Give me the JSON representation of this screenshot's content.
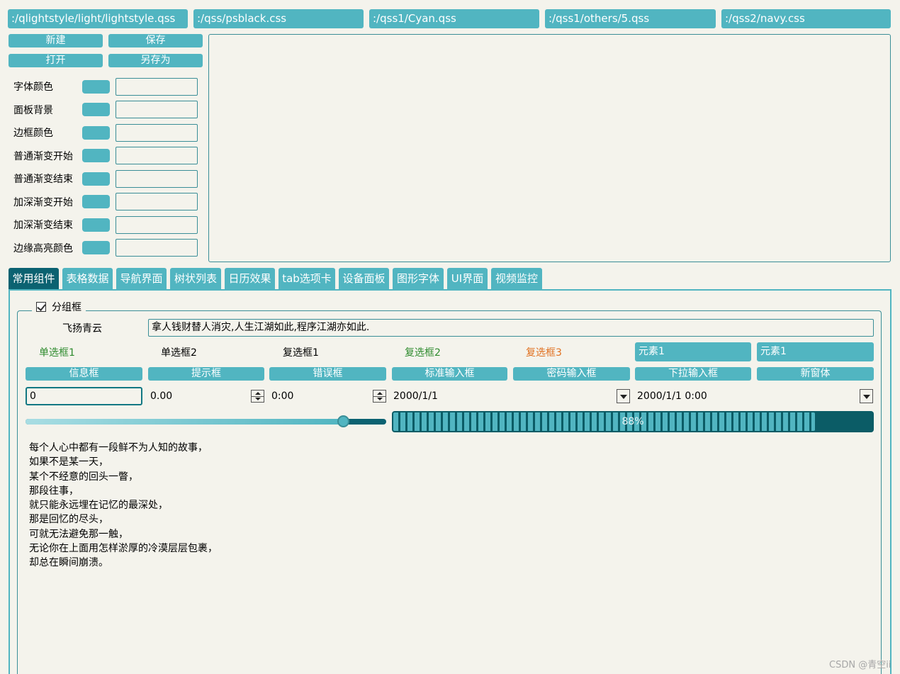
{
  "style_files": [
    ":/qlightstyle/light/lightstyle.qss",
    ":/qss/psblack.css",
    ":/qss1/Cyan.qss",
    ":/qss1/others/5.qss",
    ":/qss2/navy.css"
  ],
  "file_buttons": {
    "new": "新建",
    "save": "保存",
    "open": "打开",
    "save_as": "另存为"
  },
  "color_rows": [
    "字体颜色",
    "面板背景",
    "边框颜色",
    "普通渐变开始",
    "普通渐变结束",
    "加深渐变开始",
    "加深渐变结束",
    "边缘高亮颜色"
  ],
  "tabs": [
    "常用组件",
    "表格数据",
    "导航界面",
    "树状列表",
    "日历效果",
    "tab选项卡",
    "设备面板",
    "图形字体",
    "UI界面",
    "视频监控"
  ],
  "active_tab": "常用组件",
  "group": {
    "title": "分组框",
    "checked": true
  },
  "name_label": "飞扬青云",
  "line_edit_value": "拿人钱财替人消灾,人生江湖如此,程序江湖亦如此.",
  "radios": [
    "单选框1",
    "单选框2"
  ],
  "checks": [
    "复选框1",
    "复选框2",
    "复选框3"
  ],
  "element_combos": [
    "元素1",
    "元素1"
  ],
  "action_buttons": [
    "信息框",
    "提示框",
    "错误框",
    "标准输入框",
    "密码输入框",
    "下拉输入框",
    "新窗体"
  ],
  "spin_values": {
    "int": "0",
    "double": "0.00",
    "time": "0:00",
    "date": "2000/1/1",
    "datetime": "2000/1/1 0:00"
  },
  "slider": {
    "value_fraction": 0.88
  },
  "progress": {
    "value": 88,
    "text": "88%"
  },
  "poem": [
    "每个人心中都有一段鲜不为人知的故事，",
    "如果不是某一天，",
    "某个不经意的回头一瞥，",
    "那段往事，",
    "就只能永远埋在记忆的最深处，",
    "那是回忆的尽头，",
    "可就无法避免那一触，",
    "无论你在上面用怎样淤厚的冷漠层层包裹，",
    "却总在瞬间崩溃。"
  ],
  "watermark": "CSDN @青空ii",
  "colors": {
    "accent": "#51b5c1",
    "dark_accent": "#0b6271",
    "background": "#f4f3ec",
    "green_text": "#2e8b2e",
    "orange_text": "#e07020"
  }
}
